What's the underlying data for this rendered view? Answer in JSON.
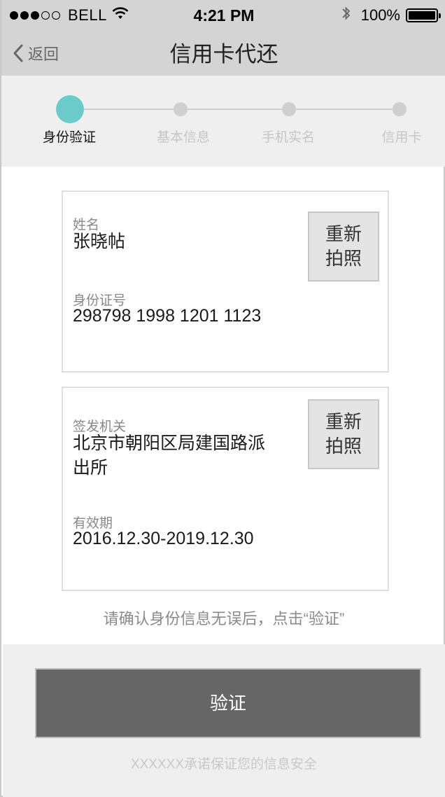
{
  "status_bar": {
    "carrier": "BELL",
    "time": "4:21 PM",
    "battery": "100%",
    "signal_icon": "signal-dots-icon",
    "wifi_icon": "wifi-icon",
    "bluetooth_icon": "bluetooth-icon",
    "battery_icon": "battery-icon"
  },
  "nav": {
    "back_label": "返回",
    "title": "信用卡代还"
  },
  "steps": [
    {
      "label": "身份验证",
      "active": true
    },
    {
      "label": "基本信息",
      "active": false
    },
    {
      "label": "手机实名",
      "active": false
    },
    {
      "label": "信用卡",
      "active": false
    }
  ],
  "card_front": {
    "name_label": "姓名",
    "name_value": "张晓帖",
    "id_label": "身份证号",
    "id_value": "298798 1998 1201 1123",
    "retake_line1": "重新",
    "retake_line2": "拍照"
  },
  "card_back": {
    "authority_label": "签发机关",
    "authority_line1": "北京市朝阳区局建国路派",
    "authority_line2": "出所",
    "validity_label": "有效期",
    "validity_value": "2016.12.30-2019.12.30",
    "retake_line1": "重新",
    "retake_line2": "拍照"
  },
  "hint": "请确认身份信息无误后，点击“验证”",
  "verify_button": "验证",
  "footer_note": "XXXXXX承诺保证您的信息安全",
  "colors": {
    "accent": "#6bcbcb",
    "bar_bg": "#d4d4d4",
    "button_bg": "#666666"
  }
}
